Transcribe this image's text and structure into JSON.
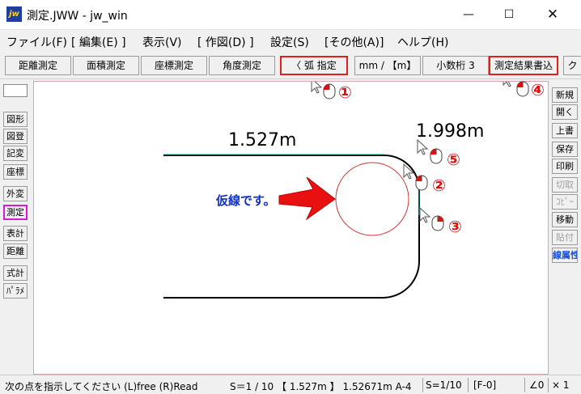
{
  "window": {
    "app_icon_text": "jw",
    "title": "測定.JWW - jw_win",
    "minimize": "—",
    "maximize": "☐",
    "close": "✕"
  },
  "menu": [
    "ファイル(F)",
    "[ 編集(E) ]",
    "表示(V)",
    "[ 作図(D) ]",
    "設定(S)",
    "[その他(A)]",
    "ヘルプ(H)"
  ],
  "toolbar": {
    "buttons": [
      "距離測定",
      "面積測定",
      "座標測定",
      "角度測定",
      "〈 弧 指定",
      "mm / 【m】",
      "小数桁 3",
      "測定結果書込",
      "ク"
    ],
    "highlighted": [
      "〈 弧 指定",
      "測定結果書込"
    ]
  },
  "left_panel": [
    "図形",
    "図登",
    "記変",
    "座標",
    "外変",
    "測定",
    "表計",
    "距離",
    "式計",
    "ﾊﾟﾗﾒ"
  ],
  "left_panel_active": "測定",
  "right_panel": [
    "新規",
    "開く",
    "上書",
    "保存",
    "印刷",
    "切取",
    "ｺﾋﾟｰ",
    "移動",
    "貼付",
    "線属性"
  ],
  "right_panel_disabled": [
    "切取",
    "ｺﾋﾟｰ",
    "貼付"
  ],
  "drawing": {
    "measure_top": "1.527m",
    "measure_right": "1.998m",
    "note": "仮線です。",
    "callouts": [
      "①",
      "②",
      "③",
      "④",
      "⑤"
    ]
  },
  "colors": {
    "highlight_red": "#e02020",
    "active_magenta": "#d81ad8",
    "note_blue": "#1030c8",
    "arrow_red": "#e81010",
    "aux_circle": "#e03030",
    "cyan_line": "#00a0a0"
  },
  "status": {
    "hint": "次の点を指示してください (L)free (R)Read",
    "scale_length": "S＝1 / 10 【 1.527m 】 1.52671m A-4",
    "scale": "S=1/10",
    "layer": "[F-0]",
    "angle": "∠0",
    "zoom": "× 1"
  }
}
